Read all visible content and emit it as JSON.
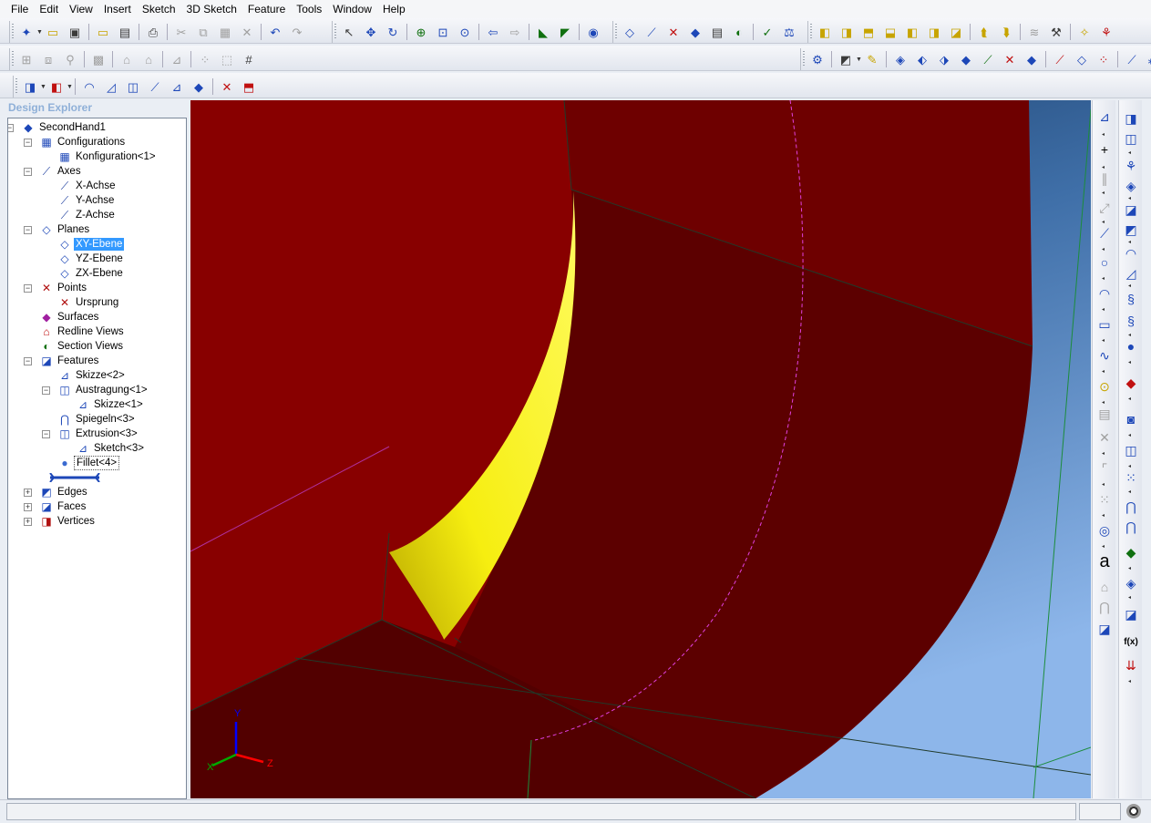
{
  "menu": [
    "File",
    "Edit",
    "View",
    "Insert",
    "Sketch",
    "3D Sketch",
    "Feature",
    "Tools",
    "Window",
    "Help"
  ],
  "explorer": {
    "title": "Design Explorer",
    "tree": [
      {
        "label": "SecondHand1",
        "icon": "part-icon",
        "level": 0,
        "expander": "−"
      },
      {
        "label": "Configurations",
        "icon": "table-icon",
        "level": 1,
        "expander": "−"
      },
      {
        "label": "Konfiguration<1>",
        "icon": "table-icon",
        "level": 2
      },
      {
        "label": "Axes",
        "icon": "axis-icon",
        "level": 1,
        "expander": "−"
      },
      {
        "label": "X-Achse",
        "icon": "axis-icon",
        "level": 2
      },
      {
        "label": "Y-Achse",
        "icon": "axis-icon",
        "level": 2
      },
      {
        "label": "Z-Achse",
        "icon": "axis-icon",
        "level": 2
      },
      {
        "label": "Planes",
        "icon": "plane-icon",
        "level": 1,
        "expander": "−"
      },
      {
        "label": "XY-Ebene",
        "icon": "plane-icon",
        "level": 2,
        "selected": true
      },
      {
        "label": "YZ-Ebene",
        "icon": "plane-icon",
        "level": 2
      },
      {
        "label": "ZX-Ebene",
        "icon": "plane-icon",
        "level": 2
      },
      {
        "label": "Points",
        "icon": "point-icon",
        "level": 1,
        "expander": "−"
      },
      {
        "label": "Ursprung",
        "icon": "point-icon",
        "level": 2
      },
      {
        "label": "Surfaces",
        "icon": "surface-icon",
        "level": 1
      },
      {
        "label": "Redline Views",
        "icon": "redline-icon",
        "level": 1
      },
      {
        "label": "Section Views",
        "icon": "section-icon",
        "level": 1
      },
      {
        "label": "Features",
        "icon": "features-icon",
        "level": 1,
        "expander": "−"
      },
      {
        "label": "Skizze<2>",
        "icon": "sketch-icon",
        "level": 2
      },
      {
        "label": "Austragung<1>",
        "icon": "extrude-icon",
        "level": 2,
        "expander": "−"
      },
      {
        "label": "Skizze<1>",
        "icon": "sketch-icon",
        "level": 3
      },
      {
        "label": "Spiegeln<3>",
        "icon": "mirror-icon",
        "level": 2
      },
      {
        "label": "Extrusion<3>",
        "icon": "extrude-icon",
        "level": 2,
        "expander": "−"
      },
      {
        "label": "Sketch<3>",
        "icon": "sketch-icon",
        "level": 3
      },
      {
        "label": "Fillet<4>",
        "icon": "fillet-icon",
        "level": 2,
        "focused": true
      },
      {
        "label": "",
        "icon": "rollback-bar-icon",
        "level": 1
      },
      {
        "label": "Edges",
        "icon": "edges-icon",
        "level": 1,
        "expander": "+"
      },
      {
        "label": "Faces",
        "icon": "faces-icon",
        "level": 1,
        "expander": "+"
      },
      {
        "label": "Vertices",
        "icon": "vertices-icon",
        "level": 1,
        "expander": "+"
      }
    ]
  },
  "triad": {
    "x": "X",
    "y": "Y",
    "z": "Z"
  },
  "colors": {
    "red_face": "#8a0000",
    "dark_face": "#5e0000",
    "fillet": "#f4f000",
    "background_top": "#1c3f6e",
    "background_bottom": "#8ab4e8",
    "selection": "#3399ff"
  }
}
